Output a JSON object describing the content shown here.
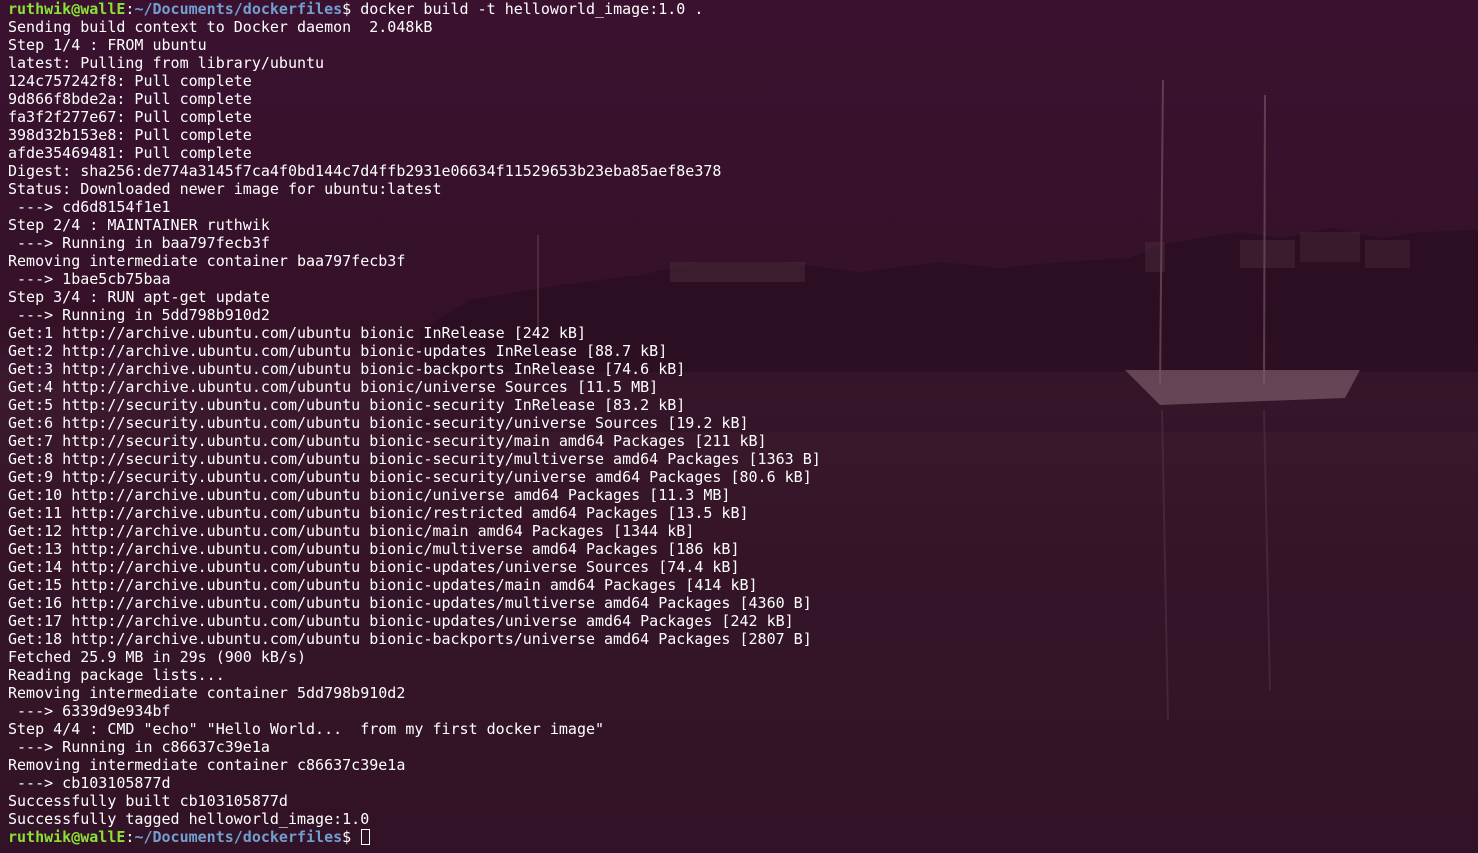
{
  "theme": {
    "background": "#3a1230",
    "foreground": "#ffffff",
    "prompt_user_color": "#8ae234",
    "prompt_path_color": "#729fcf"
  },
  "prompt": {
    "user_host": "ruthwik@wallE",
    "separator": ":",
    "path": "~/Documents/dockerfiles",
    "dollar": "$"
  },
  "command": " docker build -t helloworld_image:1.0 .",
  "output_lines": [
    "Sending build context to Docker daemon  2.048kB",
    "Step 1/4 : FROM ubuntu",
    "latest: Pulling from library/ubuntu",
    "124c757242f8: Pull complete",
    "9d866f8bde2a: Pull complete",
    "fa3f2f277e67: Pull complete",
    "398d32b153e8: Pull complete",
    "afde35469481: Pull complete",
    "Digest: sha256:de774a3145f7ca4f0bd144c7d4ffb2931e06634f11529653b23eba85aef8e378",
    "Status: Downloaded newer image for ubuntu:latest",
    " ---> cd6d8154f1e1",
    "Step 2/4 : MAINTAINER ruthwik",
    " ---> Running in baa797fecb3f",
    "Removing intermediate container baa797fecb3f",
    " ---> 1bae5cb75baa",
    "Step 3/4 : RUN apt-get update",
    " ---> Running in 5dd798b910d2",
    "Get:1 http://archive.ubuntu.com/ubuntu bionic InRelease [242 kB]",
    "Get:2 http://archive.ubuntu.com/ubuntu bionic-updates InRelease [88.7 kB]",
    "Get:3 http://archive.ubuntu.com/ubuntu bionic-backports InRelease [74.6 kB]",
    "Get:4 http://archive.ubuntu.com/ubuntu bionic/universe Sources [11.5 MB]",
    "Get:5 http://security.ubuntu.com/ubuntu bionic-security InRelease [83.2 kB]",
    "Get:6 http://security.ubuntu.com/ubuntu bionic-security/universe Sources [19.2 kB]",
    "Get:7 http://security.ubuntu.com/ubuntu bionic-security/main amd64 Packages [211 kB]",
    "Get:8 http://security.ubuntu.com/ubuntu bionic-security/multiverse amd64 Packages [1363 B]",
    "Get:9 http://security.ubuntu.com/ubuntu bionic-security/universe amd64 Packages [80.6 kB]",
    "Get:10 http://archive.ubuntu.com/ubuntu bionic/universe amd64 Packages [11.3 MB]",
    "Get:11 http://archive.ubuntu.com/ubuntu bionic/restricted amd64 Packages [13.5 kB]",
    "Get:12 http://archive.ubuntu.com/ubuntu bionic/main amd64 Packages [1344 kB]",
    "Get:13 http://archive.ubuntu.com/ubuntu bionic/multiverse amd64 Packages [186 kB]",
    "Get:14 http://archive.ubuntu.com/ubuntu bionic-updates/universe Sources [74.4 kB]",
    "Get:15 http://archive.ubuntu.com/ubuntu bionic-updates/main amd64 Packages [414 kB]",
    "Get:16 http://archive.ubuntu.com/ubuntu bionic-updates/multiverse amd64 Packages [4360 B]",
    "Get:17 http://archive.ubuntu.com/ubuntu bionic-updates/universe amd64 Packages [242 kB]",
    "Get:18 http://archive.ubuntu.com/ubuntu bionic-backports/universe amd64 Packages [2807 B]",
    "Fetched 25.9 MB in 29s (900 kB/s)",
    "Reading package lists...",
    "Removing intermediate container 5dd798b910d2",
    " ---> 6339d9e934bf",
    "Step 4/4 : CMD \"echo\" \"Hello World...  from my first docker image\"",
    " ---> Running in c86637c39e1a",
    "Removing intermediate container c86637c39e1a",
    " ---> cb103105877d",
    "Successfully built cb103105877d",
    "Successfully tagged helloworld_image:1.0"
  ]
}
